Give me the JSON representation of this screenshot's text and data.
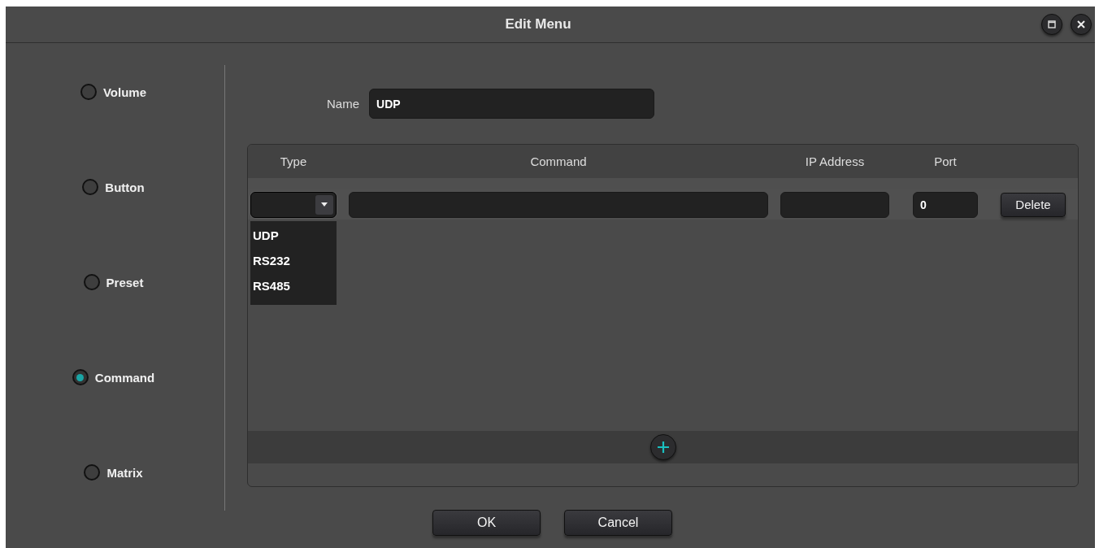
{
  "window": {
    "title": "Edit Menu"
  },
  "menu_types": [
    {
      "label": "Volume",
      "selected": false
    },
    {
      "label": "Button",
      "selected": false
    },
    {
      "label": "Preset",
      "selected": false
    },
    {
      "label": "Command",
      "selected": true
    },
    {
      "label": "Matrix",
      "selected": false
    }
  ],
  "name_field": {
    "label": "Name",
    "value": "UDP"
  },
  "command_table": {
    "columns": [
      "Type",
      "Command",
      "IP Address",
      "Port"
    ],
    "rows": [
      {
        "port": "0",
        "delete_button": "Delete",
        "type_dropdown": {
          "expanded": true,
          "options": [
            "UDP",
            "RS232",
            "RS485"
          ]
        }
      }
    ]
  },
  "buttons": [
    "OK",
    "Cancel"
  ]
}
